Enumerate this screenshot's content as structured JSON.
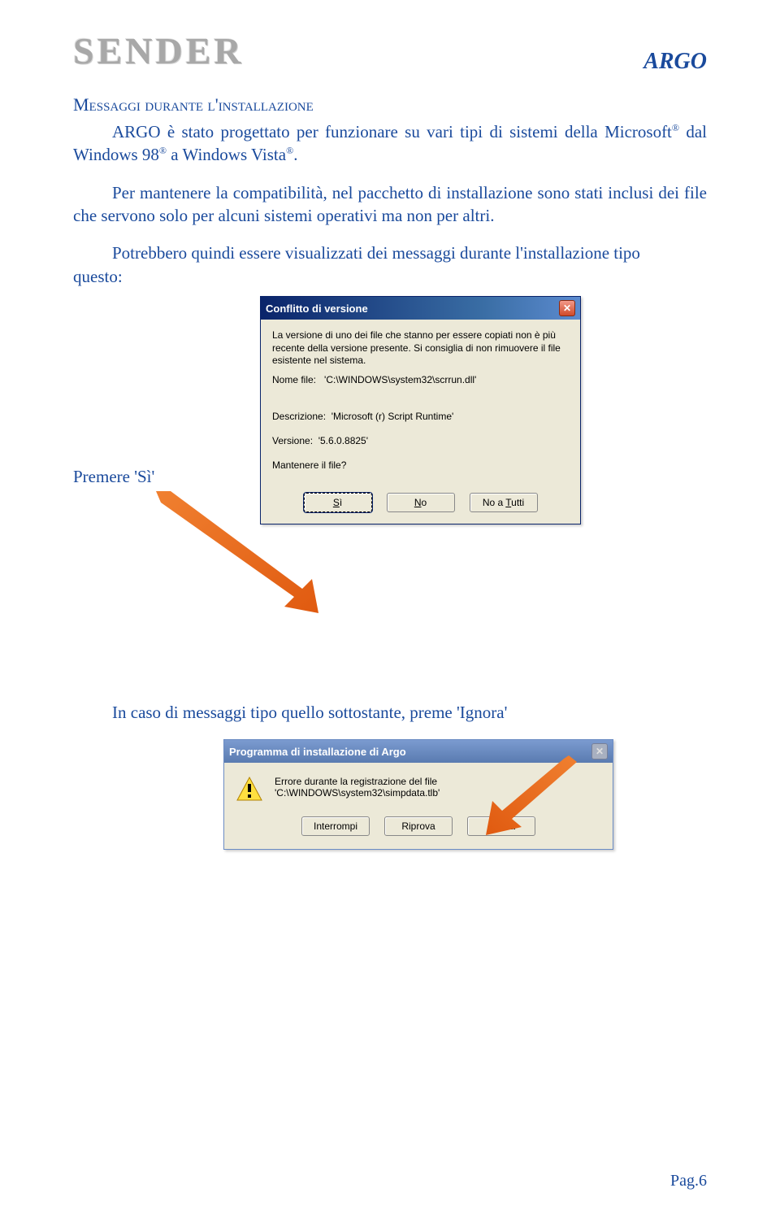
{
  "logo": "SENDER",
  "brand": "ARGO",
  "section_title": "Messaggi durante l'installazione",
  "para1_pre": "ARGO è stato progettato per funzionare su vari tipi di sistemi della Microsoft",
  "para1_post": " dal Windows 98",
  "para1_end": " a Windows Vista",
  "para1_dot": ".",
  "reg": "®",
  "para2": "Per mantenere la compatibilità, nel pacchetto di installazione sono stati inclusi dei file che servono solo per alcuni sistemi operativi ma non per altri.",
  "para3_pre": "Potrebbero quindi essere visualizzati dei messaggi durante l'installazione tipo",
  "para3_post": "questo:",
  "premere": "Premere 'Sì'",
  "dialog1": {
    "title": "Conflitto di versione",
    "msg": "La versione di uno dei file che stanno per essere copiati non è più recente della versione presente. Si consiglia di non rimuovere il file esistente nel sistema.",
    "filename_label": "Nome file:",
    "filename_value": "'C:\\WINDOWS\\system32\\scrrun.dll'",
    "desc_label": "Descrizione:",
    "desc_value": "'Microsoft (r) Script Runtime'",
    "ver_label": "Versione:",
    "ver_value": "'5.6.0.8825'",
    "keep": "Mantenere il file?",
    "btn_yes": "Sì",
    "btn_no": "No",
    "btn_noall": "No a Tutti",
    "yes_u": "S",
    "no_u": "N",
    "noall_u": "T"
  },
  "para4": "In caso di messaggi tipo quello sottostante, preme 'Ignora'",
  "dialog2": {
    "title": "Programma di installazione di Argo",
    "msg": "Errore durante la registrazione del file 'C:\\WINDOWS\\system32\\simpdata.tlb'",
    "btn_abort": "Interrompi",
    "btn_retry": "Riprova",
    "btn_ignore": "Ignora"
  },
  "page": "Pag.6"
}
